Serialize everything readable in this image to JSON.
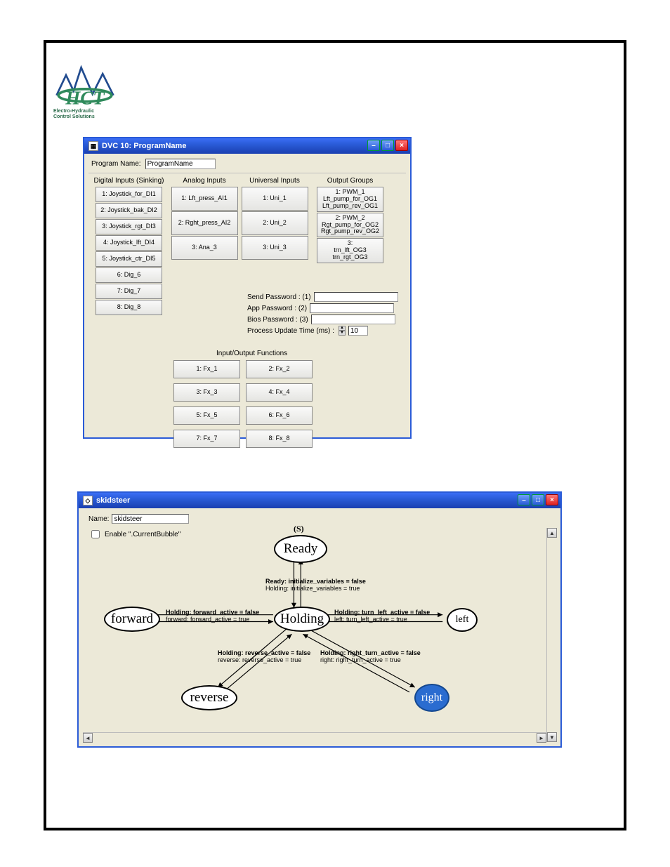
{
  "logo": {
    "line1": "Electro-Hydraulic",
    "line2": "Control Solutions"
  },
  "win1": {
    "title": "DVC 10: ProgramName",
    "program_name_label": "Program Name:",
    "program_name_value": "ProgramName",
    "headers": {
      "dig": "Digital Inputs (Sinking)",
      "ana": "Analog Inputs",
      "uni": "Universal Inputs",
      "out": "Output Groups"
    },
    "dig": [
      "1: Joystick_for_DI1",
      "2: Joystick_bak_DI2",
      "3: Joystick_rgt_DI3",
      "4: Joystick_lft_DI4",
      "5: Joystick_ctr_DI5",
      "6: Dig_6",
      "7: Dig_7",
      "8: Dig_8"
    ],
    "ana": [
      "1: Lft_press_AI1",
      "2: Rght_press_AI2",
      "3: Ana_3"
    ],
    "uni": [
      "1: Uni_1",
      "2: Uni_2",
      "3: Uni_3"
    ],
    "out": [
      "1: PWM_1\nLft_pump_for_OG1\nLft_pump_rev_OG1",
      "2: PWM_2\nRgt_pump_for_OG2\nRgt_pump_rev_OG2",
      "3:\ntrn_lft_OG3\ntrn_rgt_OG3"
    ],
    "pw": {
      "send": "Send Password : (1)",
      "app": "App Password : (2)",
      "bios": "Bios Password : (3)",
      "put": "Process Update Time (ms) :",
      "put_val": "10"
    },
    "io_header": "Input/Output Functions",
    "fx": [
      "1: Fx_1",
      "2: Fx_2",
      "3: Fx_3",
      "4: Fx_4",
      "5: Fx_5",
      "6: Fx_6",
      "7: Fx_7",
      "8: Fx_8"
    ]
  },
  "win2": {
    "title": "skidsteer",
    "name_label": "Name:",
    "name_value": "skidsteer",
    "chk_label": "Enable \".CurrentBubble\"",
    "s_label": "(S)",
    "bubbles": {
      "ready": "Ready",
      "holding": "Holding",
      "forward": "forward",
      "reverse": "reverse",
      "left": "left",
      "right": "right"
    },
    "transitions": {
      "rh1": "Ready: initialize_variables = false",
      "rh2": "Holding: initialize_variables = true",
      "fw1": "Holding: forward_active = false",
      "fw2": "forward: forward_active = true",
      "lf1": "Holding: turn_left_active = false",
      "lf2": "left: turn_left_active = true",
      "rv1": "Holding: reverse_active = false",
      "rv2": "reverse: reverse_active = true",
      "rt1": "Holding: right_turn_active = false",
      "rt2": "right: right_turn_active = true"
    }
  }
}
